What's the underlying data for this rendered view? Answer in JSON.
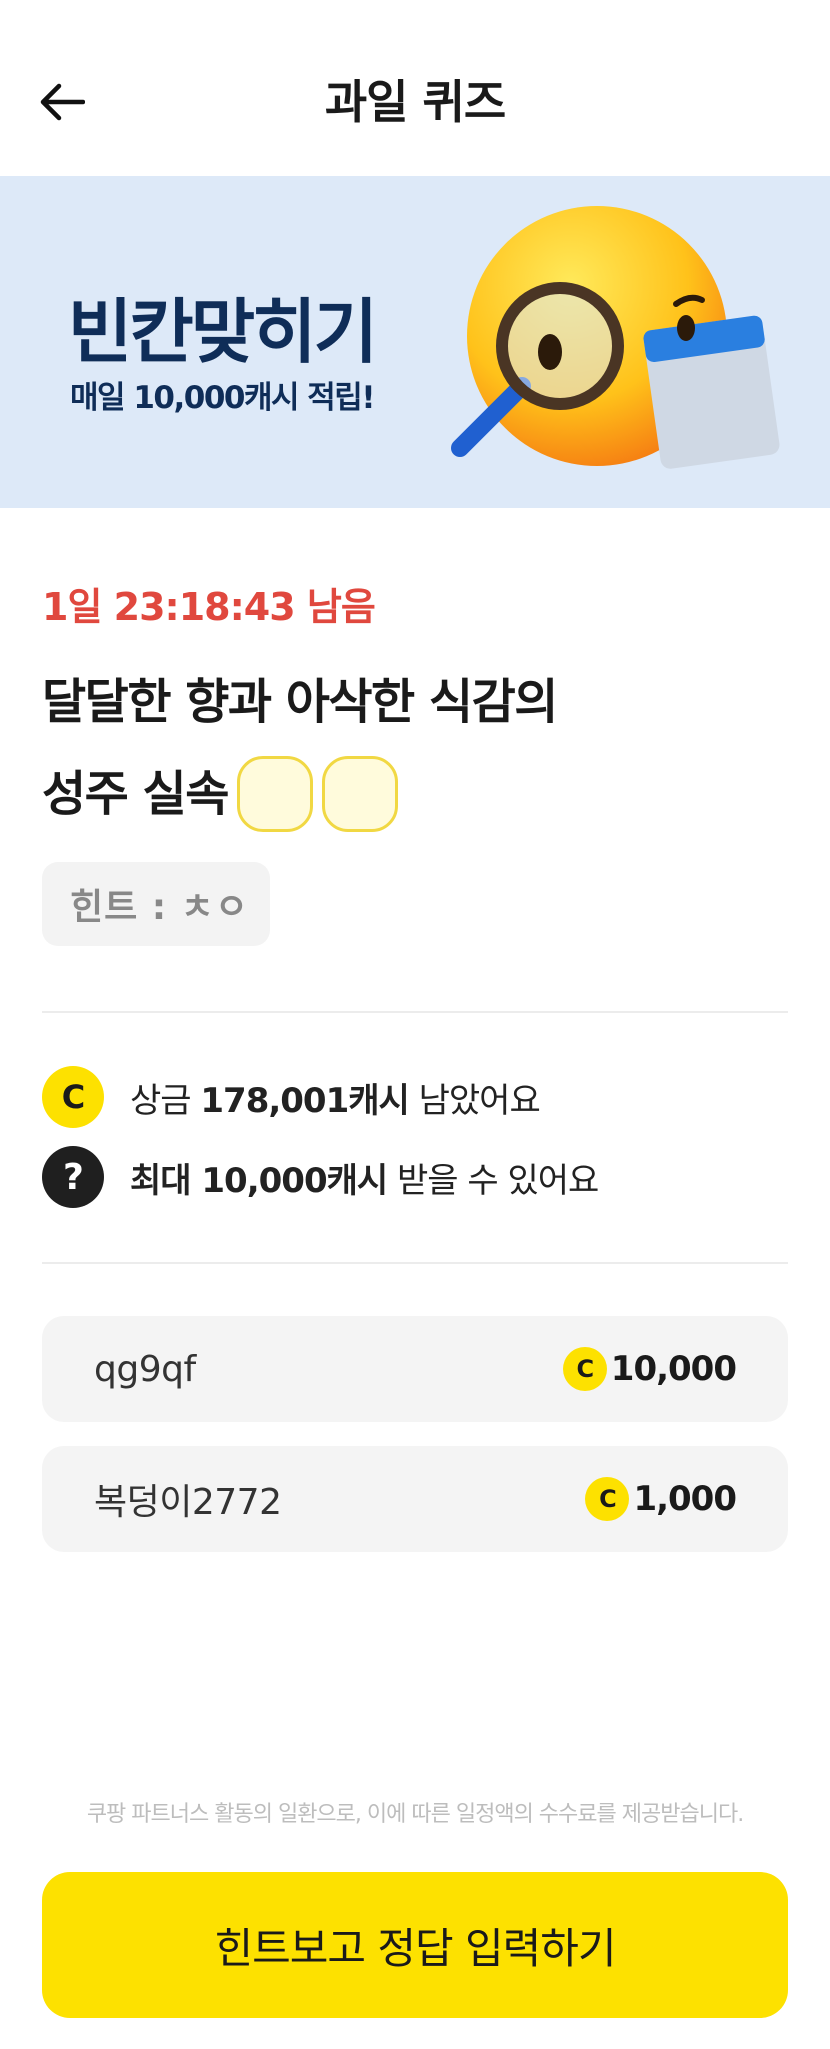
{
  "header": {
    "title": "과일 퀴즈"
  },
  "banner": {
    "title": "빈칸맞히기",
    "subtitle": "매일 10,000캐시 적립!"
  },
  "quiz": {
    "countdown": "1일 23:18:43 남음",
    "question_line1": "달달한 향과 아삭한 식감의",
    "question_line2": "성주 실속",
    "hint": "힌트 : ㅊㅇ"
  },
  "info": {
    "prize_prefix": "상금",
    "prize_amount": "178,001캐시",
    "prize_suffix": "남았어요",
    "max_bold": "최대 10,000캐시",
    "max_suffix": "받을 수 있어요",
    "coin_symbol": "C",
    "question_symbol": "?"
  },
  "ranking": [
    {
      "name": "qg9qf",
      "amount": "10,000"
    },
    {
      "name": "복덩이2772",
      "amount": "1,000"
    }
  ],
  "disclaimer": "쿠팡 파트너스 활동의 일환으로, 이에 따른 일정액의 수수료를 제공받습니다.",
  "cta": {
    "label": "힌트보고 정답 입력하기"
  },
  "colors": {
    "accent_yellow": "#fde100",
    "countdown_red": "#e0483e",
    "banner_bg": "#dde9f8",
    "banner_text": "#0f2d58"
  }
}
